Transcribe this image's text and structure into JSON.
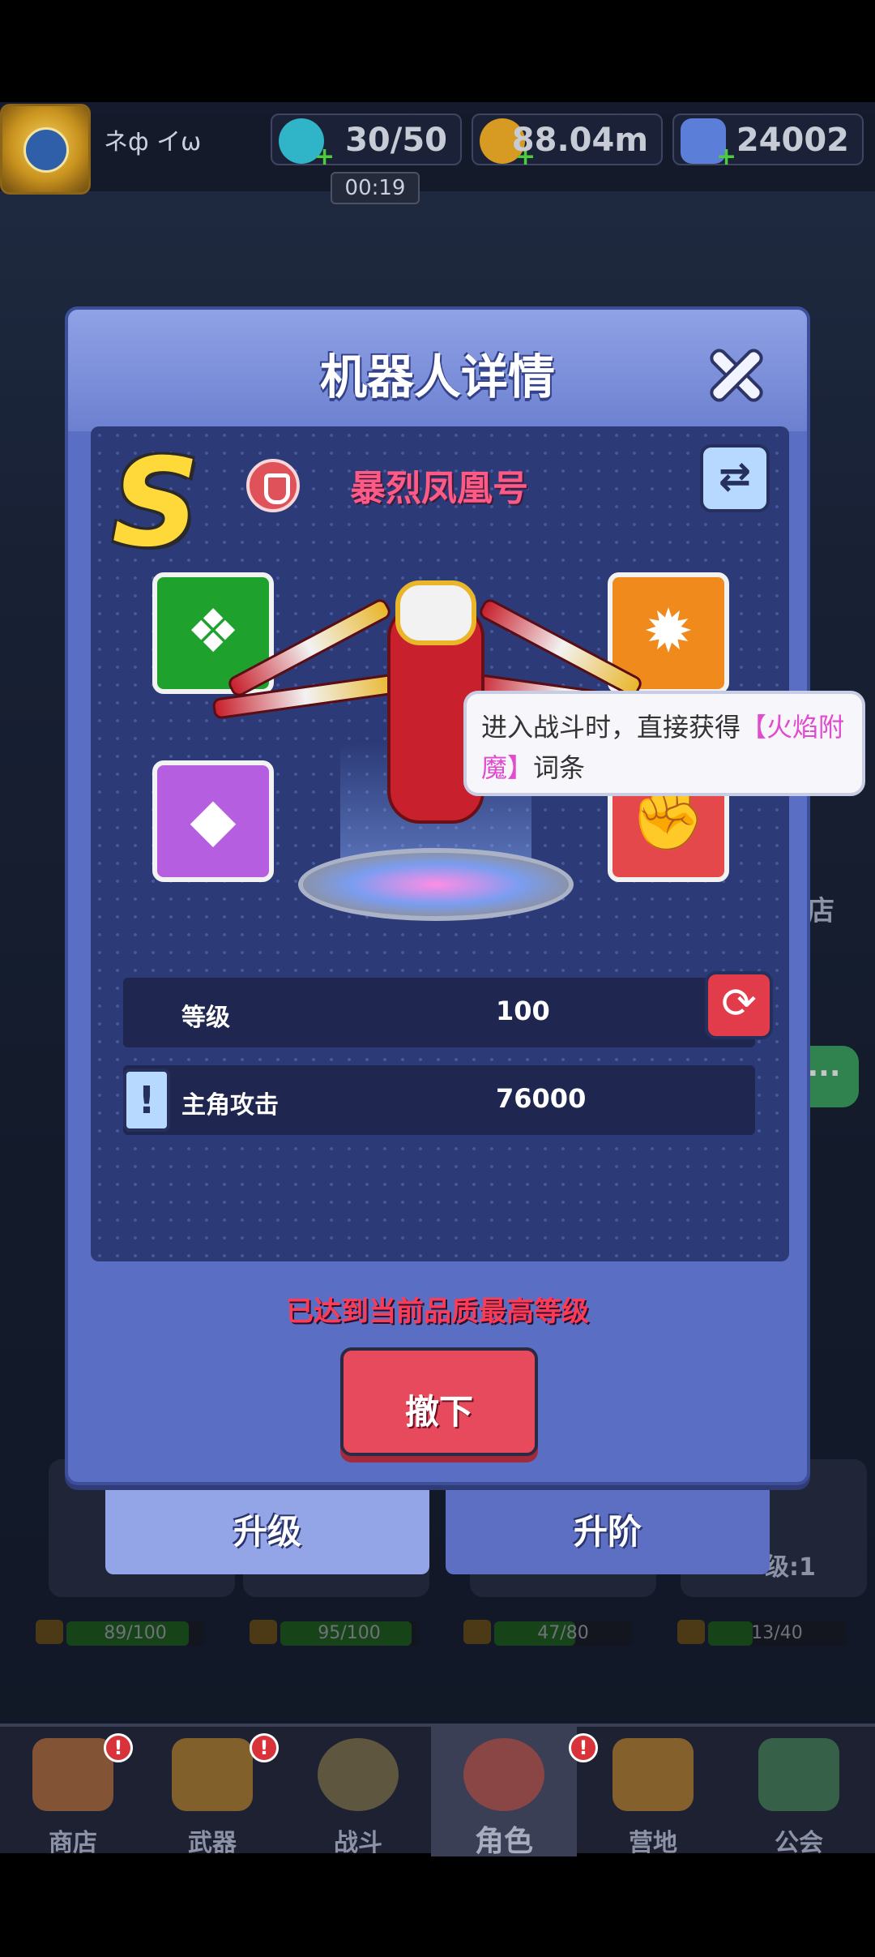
{
  "header": {
    "player_name": "ネф イω",
    "stamina": "30/50",
    "coins": "88.04m",
    "gems": "24002",
    "timer": "00:19"
  },
  "modal": {
    "title": "机器人详情",
    "rank": "S",
    "robot_name": "暴烈凤凰号",
    "stats": [
      {
        "label": "等级",
        "value": "100"
      },
      {
        "label": "主角攻击",
        "value": "76000"
      }
    ],
    "max_message": "已达到当前品质最高等级",
    "withdraw_label": "撤下",
    "tooltip_prefix": "进入战斗时，直接获得",
    "tooltip_highlight": "【火焰附魔】",
    "tooltip_suffix": "词条"
  },
  "tabs": {
    "upgrade": "升级",
    "advance": "升阶"
  },
  "background_cards": [
    {
      "progress": "89/100"
    },
    {
      "progress": "95/100"
    },
    {
      "progress": "47/80"
    },
    {
      "progress": "13/40"
    }
  ],
  "background_partial": {
    "right_edge_text": "店",
    "card_level_text": "级:1"
  },
  "nav": {
    "items": [
      {
        "label": "商店"
      },
      {
        "label": "武器"
      },
      {
        "label": "战斗"
      },
      {
        "label": "角色"
      },
      {
        "label": "营地"
      },
      {
        "label": "公会"
      }
    ]
  },
  "colors": {
    "modal_bg": "#5a6fc4",
    "robot_name": "#ff5a86",
    "max_message": "#ff3a55",
    "withdraw_button": "#e74a5c",
    "rank": "#ffd93a"
  }
}
